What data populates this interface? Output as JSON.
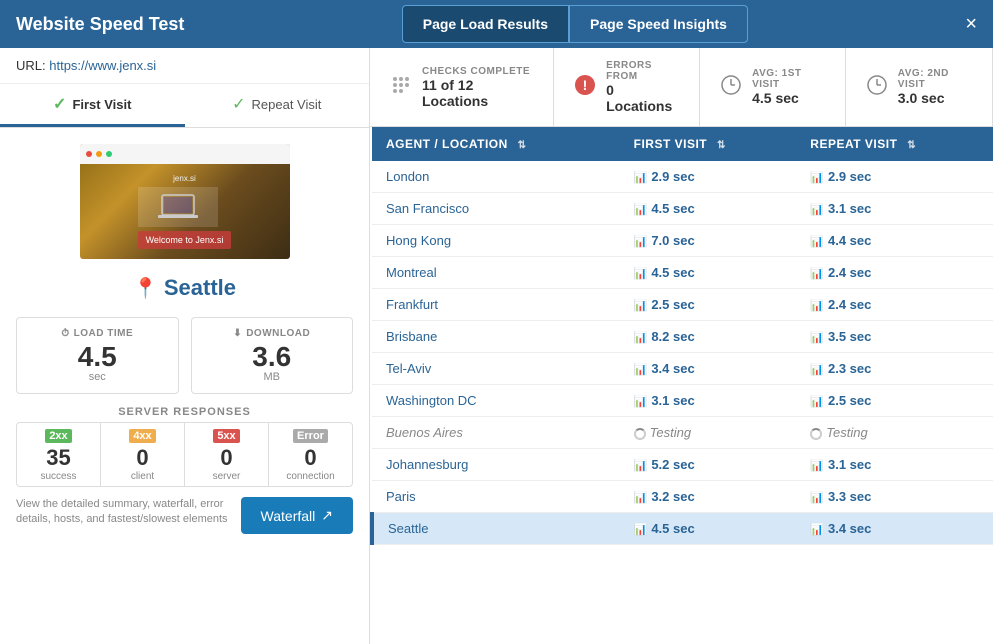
{
  "header": {
    "title": "Website Speed Test",
    "tabs": [
      {
        "id": "page-load",
        "label": "Page Load Results",
        "active": true
      },
      {
        "id": "page-speed",
        "label": "Page Speed Insights",
        "active": false
      }
    ],
    "close_label": "×"
  },
  "url_bar": {
    "prefix": "URL:",
    "url": "https://www.jenx.si"
  },
  "visit_tabs": [
    {
      "id": "first",
      "label": "First Visit",
      "active": true
    },
    {
      "id": "repeat",
      "label": "Repeat Visit",
      "active": false
    }
  ],
  "location": {
    "name": "Seattle",
    "pin_icon": "📍"
  },
  "metrics": [
    {
      "id": "load-time",
      "label": "LOAD TIME",
      "icon": "⏱",
      "value": "4.5",
      "unit": "sec"
    },
    {
      "id": "download",
      "label": "DOWNLOAD",
      "icon": "⬇",
      "value": "3.6",
      "unit": "MB"
    }
  ],
  "server_responses": {
    "label": "SERVER RESPONSES",
    "codes": [
      {
        "badge": "2xx",
        "class": "rc-2xx",
        "count": "35",
        "desc": "success"
      },
      {
        "badge": "4xx",
        "class": "rc-4xx",
        "count": "0",
        "desc": "client"
      },
      {
        "badge": "5xx",
        "class": "rc-5xx",
        "count": "0",
        "desc": "server"
      },
      {
        "badge": "Error",
        "class": "rc-err",
        "count": "0",
        "desc": "connection"
      }
    ]
  },
  "waterfall": {
    "desc": "View the detailed summary, waterfall, error details, hosts, and fastest/slowest elements",
    "btn_label": "Waterfall"
  },
  "stats_bar": {
    "checks": {
      "label": "CHECKS COMPLETE",
      "value": "11 of 12 Locations"
    },
    "errors": {
      "label": "ERRORS FROM",
      "value": "0 Locations"
    },
    "avg_first": {
      "label": "AVG: 1ST VISIT",
      "value": "4.5 sec"
    },
    "avg_second": {
      "label": "AVG: 2ND VISIT",
      "value": "3.0 sec"
    }
  },
  "table": {
    "columns": [
      {
        "id": "location",
        "label": "AGENT / LOCATION"
      },
      {
        "id": "first-visit",
        "label": "FIRST VISIT"
      },
      {
        "id": "repeat-visit",
        "label": "REPEAT VISIT"
      }
    ],
    "rows": [
      {
        "location": "London",
        "first_visit": "2.9 sec",
        "repeat_visit": "2.9 sec",
        "testing": false,
        "selected": false
      },
      {
        "location": "San Francisco",
        "first_visit": "4.5 sec",
        "repeat_visit": "3.1 sec",
        "testing": false,
        "selected": false
      },
      {
        "location": "Hong Kong",
        "first_visit": "7.0 sec",
        "repeat_visit": "4.4 sec",
        "testing": false,
        "selected": false
      },
      {
        "location": "Montreal",
        "first_visit": "4.5 sec",
        "repeat_visit": "2.4 sec",
        "testing": false,
        "selected": false
      },
      {
        "location": "Frankfurt",
        "first_visit": "2.5 sec",
        "repeat_visit": "2.4 sec",
        "testing": false,
        "selected": false
      },
      {
        "location": "Brisbane",
        "first_visit": "8.2 sec",
        "repeat_visit": "3.5 sec",
        "testing": false,
        "selected": false
      },
      {
        "location": "Tel-Aviv",
        "first_visit": "3.4 sec",
        "repeat_visit": "2.3 sec",
        "testing": false,
        "selected": false
      },
      {
        "location": "Washington DC",
        "first_visit": "3.1 sec",
        "repeat_visit": "2.5 sec",
        "testing": false,
        "selected": false
      },
      {
        "location": "Buenos Aires",
        "first_visit": "Testing",
        "repeat_visit": "Testing",
        "testing": true,
        "selected": false
      },
      {
        "location": "Johannesburg",
        "first_visit": "5.2 sec",
        "repeat_visit": "3.1 sec",
        "testing": false,
        "selected": false
      },
      {
        "location": "Paris",
        "first_visit": "3.2 sec",
        "repeat_visit": "3.3 sec",
        "testing": false,
        "selected": false
      },
      {
        "location": "Seattle",
        "first_visit": "4.5 sec",
        "repeat_visit": "3.4 sec",
        "testing": false,
        "selected": true
      }
    ]
  }
}
